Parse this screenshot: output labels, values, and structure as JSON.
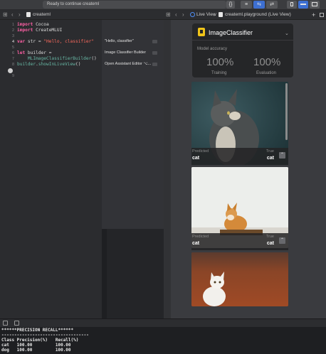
{
  "toolbar": {
    "status": "Ready to continue createml",
    "buttons": [
      "{}",
      "≡",
      "⇆",
      "⇄"
    ]
  },
  "left_jumpbar": {
    "file": "createml"
  },
  "right_jumpbar": {
    "mode": "Live View",
    "file": "createml.playground (Live View)",
    "add": "+"
  },
  "editor": {
    "line_numbers": [
      "1",
      "2",
      "3",
      "4",
      "5",
      "6",
      "7",
      "8",
      "9"
    ],
    "lines": [
      {
        "t": "import Cocoa"
      },
      {
        "t": "import CreateMLUI"
      },
      {
        "t": ""
      },
      {
        "t": "var str = \"Hello, classifier\""
      },
      {
        "t": ""
      },
      {
        "t": "let builder ="
      },
      {
        "t": "    MLImageClassifierBuilder()"
      },
      {
        "t": "builder.showInLiveView()"
      },
      {
        "t": ""
      }
    ]
  },
  "results": [
    "\"Hello, classifier\"",
    "Image Classifier Builder",
    "Open Assistant Editor ⌥..."
  ],
  "classifier_card": {
    "title": "ImageClassifier",
    "accuracy_label": "Model accuracy",
    "training_value": "100%",
    "training_label": "Training",
    "evaluation_value": "100%",
    "evaluation_label": "Evaluation"
  },
  "predictions": [
    {
      "predicted_label": "Predicted",
      "true_label": "True",
      "predicted": "cat",
      "true": "cat"
    },
    {
      "predicted_label": "Predicted",
      "true_label": "True",
      "predicted": "cat",
      "true": "cat"
    }
  ],
  "console": {
    "lines": [
      "******PRECISION RECALL******",
      "----------------------------------",
      "Class Precision(%)   Recall(%)",
      "cat   100.00         100.00",
      "dog   100.00         100.00"
    ]
  },
  "colors": {
    "keyword": "#fc5fa3",
    "string": "#fc6a5d",
    "accent": "#3d6fd1",
    "icon": "#f0c419"
  }
}
